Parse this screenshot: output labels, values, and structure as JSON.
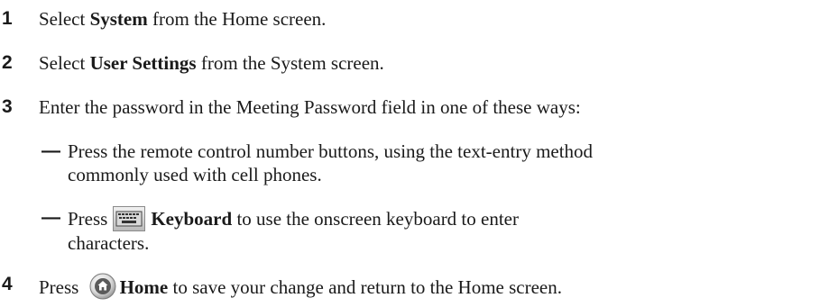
{
  "steps": [
    {
      "num": "1",
      "pre": "Select ",
      "bold": "System",
      "post": " from the Home screen."
    },
    {
      "num": "2",
      "pre": "Select ",
      "bold": "User Settings",
      "post": " from the System screen."
    },
    {
      "num": "3",
      "text": "Enter the password in the Meeting Password field in one of these ways:"
    },
    {
      "num": "4",
      "pre": "Press ",
      "bold": "Home",
      "post": " to save your change and return to the Home screen.",
      "icon": "home-button-icon"
    }
  ],
  "substeps": [
    {
      "dash": "—",
      "line1": "Press the remote control number buttons, using the text-entry method",
      "line2": "commonly used with cell phones."
    },
    {
      "dash": "—",
      "pre": "Press",
      "bold": "Keyboard",
      "post": " to use the onscreen keyboard to enter",
      "line2": "characters.",
      "icon": "keyboard-button-icon"
    }
  ]
}
